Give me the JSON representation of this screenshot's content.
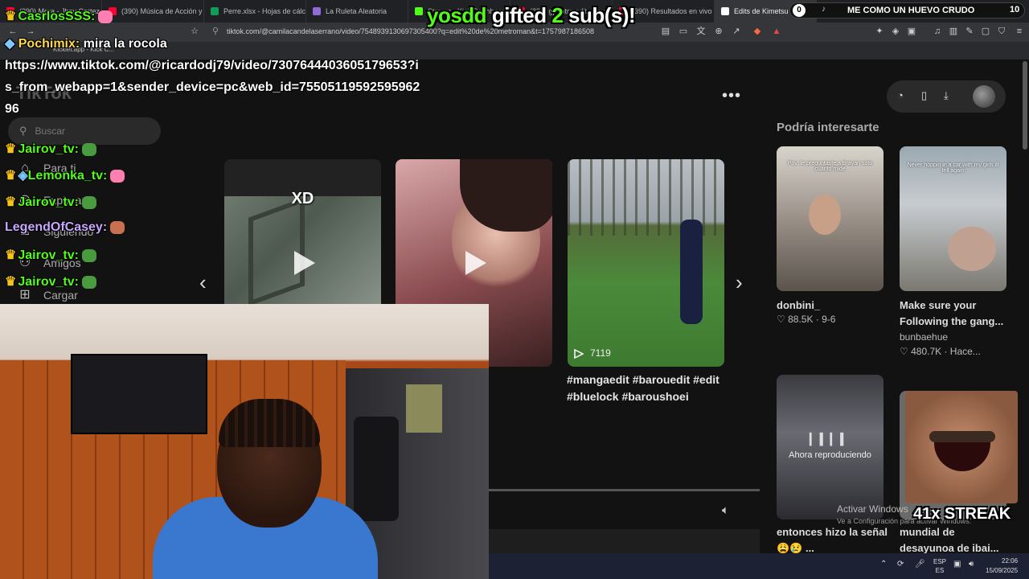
{
  "browser": {
    "tabs": [
      {
        "title": "(390) Mora - Jhay Cortez",
        "color": "#ff0033"
      },
      {
        "title": "(390) Música de Acción y",
        "color": "#ff0033"
      },
      {
        "title": "Perre.xlsx - Hojas de cálcu",
        "color": "#0f9d58"
      },
      {
        "title": "La Ruleta Aleatoria",
        "color": "#8e6bd8"
      },
      {
        "title": "Stream - Kick Dashboard",
        "color": "#53fc18"
      },
      {
        "title": "(390) gp mtro edit - You",
        "color": "#ff0033"
      },
      {
        "title": "(390) Resultados en vivo de Che",
        "color": "#ff0033"
      },
      {
        "title": "Edits de Kimetsu no",
        "color": "#ffffff"
      }
    ],
    "url": "tiktok.com/@camilacandelaserrano/video/7548939130697305400?q=edit%20de%20metroman&t=1757987186508",
    "bookmark": "Kicklet.app - Kick C..."
  },
  "tiktok": {
    "logo": "TikTok",
    "search_placeholder": "Buscar",
    "nav": [
      {
        "label": "Para ti",
        "icon": "home-icon"
      },
      {
        "label": "Explorar",
        "icon": "compass-icon"
      },
      {
        "label": "Siguiendo",
        "icon": "following-icon"
      },
      {
        "label": "Amigos",
        "icon": "friends-icon"
      },
      {
        "label": "Cargar",
        "icon": "upload-icon"
      }
    ],
    "video_cards": [
      {
        "overlay_text": "XD"
      },
      {
        "overlay_text": ""
      },
      {
        "views": "7119"
      }
    ],
    "caption": "#mangaedit #barouedit #edit #bluelock #baroushoei",
    "section_title": "Podría interesarte",
    "recommended": [
      {
        "title": "donbini_",
        "stats": "88.5K · 9-6",
        "thumb_text": "Pov: le preguntaste a Brayan soto cuanto mide"
      },
      {
        "title": "Make sure your Following the gang...",
        "author": "bunbaehue",
        "stats": "480.7K · Hace...",
        "thumb_text": "Never hoppin in a car with my girls ill tell again"
      },
      {
        "title": "entonces hizo la señal 😩😢 ...",
        "now_playing": "Ahora reproduciendo"
      },
      {
        "title": "mundial de desayunoa de ibai..."
      }
    ]
  },
  "stream_overlay": {
    "gift_alert": {
      "user": "yosdd",
      "mid": "gifted",
      "count": "2",
      "end": "sub(s)!"
    },
    "goal": {
      "left_value": "0",
      "label": "ME COMO UN HUEVO CRUDO",
      "right_value": "10"
    },
    "streak": "41x STREAK",
    "chat": [
      {
        "user": "CasrlosSSS:",
        "message": "",
        "color": "#53fc18",
        "crown": true
      },
      {
        "user": "Pochimix:",
        "message": "mira la rocola",
        "color": "#ffd84d",
        "crown": false
      },
      {
        "user": "Jairov_tv:",
        "message": "",
        "color": "#53fc18",
        "crown": true
      },
      {
        "user": "Lemonka_tv:",
        "message": "",
        "color": "#53fc18",
        "crown": true
      },
      {
        "user": "Jairov_tv:",
        "message": "",
        "color": "#53fc18",
        "crown": true
      },
      {
        "user": "LegendOfCasey:",
        "message": "",
        "color": "#c9a7ff",
        "crown": false
      },
      {
        "user": "Jairov_tv:",
        "message": "",
        "color": "#53fc18",
        "crown": true
      },
      {
        "user": "Jairov_tv:",
        "message": "",
        "color": "#53fc18",
        "crown": true
      }
    ],
    "chat_link": "https://www.tiktok.com/@ricardodj79/video/7307644403605179653?is_from_webapp=1&sender_device=pc&web_id=7550511959259596296"
  },
  "windows": {
    "activate_title": "Activar Windows",
    "activate_sub": "Ve a Configuración para activar Windows.",
    "lang_top": "ESP",
    "lang_bottom": "ES",
    "time": "22:06",
    "date": "15/09/2025"
  },
  "colors": {
    "kick_green": "#53fc18",
    "page_bg": "#121212",
    "taskbar": "#1c2233"
  }
}
